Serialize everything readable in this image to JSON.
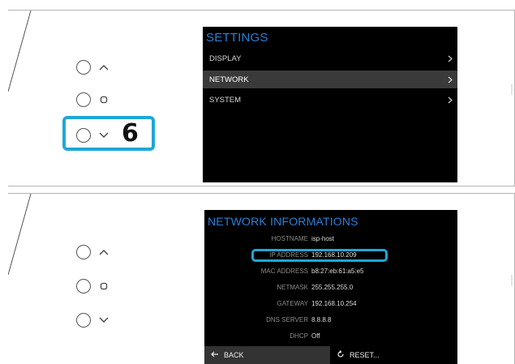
{
  "step_number": "6",
  "settings_screen": {
    "title": "SETTINGS",
    "menu": [
      {
        "label": "DISPLAY",
        "active": false
      },
      {
        "label": "NETWORK",
        "active": true
      },
      {
        "label": "SYSTEM",
        "active": false
      }
    ]
  },
  "network_screen": {
    "title": "NETWORK INFORMATIONS",
    "rows": [
      {
        "label": "HOSTNAME",
        "value": "isp-host"
      },
      {
        "label": "IP ADDRESS",
        "value": "192.168.10.209"
      },
      {
        "label": "MAC ADDRESS",
        "value": "b8:27:eb:61:a5:e5"
      },
      {
        "label": "NETMASK",
        "value": "255.255.255.0"
      },
      {
        "label": "GATEWAY",
        "value": "192.168.10.254"
      },
      {
        "label": "DNS SERVER",
        "value": "8.8.8.8"
      },
      {
        "label": "DHCP",
        "value": "Off"
      }
    ],
    "back_label": "BACK",
    "reset_label": "RESET..."
  },
  "colors": {
    "highlight": "#1fa7d6",
    "title_blue": "#2a7fd6",
    "screen_bg": "#000000",
    "active_row": "#3a3a3a"
  },
  "icons": {
    "up": "chevron-up-icon",
    "ok": "square-ok-icon",
    "down": "chevron-down-icon",
    "back": "arrow-left-icon",
    "reset": "refresh-icon",
    "menu_arrow": "chevron-right-icon"
  }
}
